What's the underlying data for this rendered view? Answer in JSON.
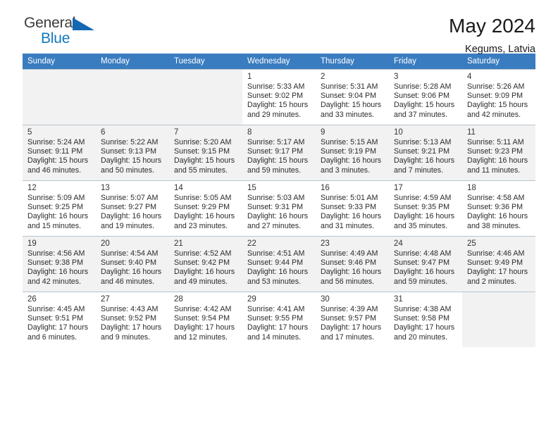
{
  "brand": {
    "name_part1": "General",
    "name_part2": "Blue",
    "triangle_icon": "triangle-icon",
    "accent_color": "#1268b3"
  },
  "header": {
    "title": "May 2024",
    "subtitle": "Kegums, Latvia"
  },
  "calendar": {
    "header_color": "#3a7cc0",
    "weekdays": [
      "Sunday",
      "Monday",
      "Tuesday",
      "Wednesday",
      "Thursday",
      "Friday",
      "Saturday"
    ],
    "labels": {
      "sunrise": "Sunrise:",
      "sunset": "Sunset:",
      "daylight": "Daylight:"
    },
    "weeks": [
      [
        {
          "day": "",
          "sunrise": "",
          "sunset": "",
          "daylight": "",
          "empty": true
        },
        {
          "day": "",
          "sunrise": "",
          "sunset": "",
          "daylight": "",
          "empty": true
        },
        {
          "day": "",
          "sunrise": "",
          "sunset": "",
          "daylight": "",
          "empty": true
        },
        {
          "day": "1",
          "sunrise": "Sunrise: 5:33 AM",
          "sunset": "Sunset: 9:02 PM",
          "daylight": "Daylight: 15 hours and 29 minutes.",
          "empty": false
        },
        {
          "day": "2",
          "sunrise": "Sunrise: 5:31 AM",
          "sunset": "Sunset: 9:04 PM",
          "daylight": "Daylight: 15 hours and 33 minutes.",
          "empty": false
        },
        {
          "day": "3",
          "sunrise": "Sunrise: 5:28 AM",
          "sunset": "Sunset: 9:06 PM",
          "daylight": "Daylight: 15 hours and 37 minutes.",
          "empty": false
        },
        {
          "day": "4",
          "sunrise": "Sunrise: 5:26 AM",
          "sunset": "Sunset: 9:09 PM",
          "daylight": "Daylight: 15 hours and 42 minutes.",
          "empty": false
        }
      ],
      [
        {
          "day": "5",
          "sunrise": "Sunrise: 5:24 AM",
          "sunset": "Sunset: 9:11 PM",
          "daylight": "Daylight: 15 hours and 46 minutes.",
          "empty": false
        },
        {
          "day": "6",
          "sunrise": "Sunrise: 5:22 AM",
          "sunset": "Sunset: 9:13 PM",
          "daylight": "Daylight: 15 hours and 50 minutes.",
          "empty": false
        },
        {
          "day": "7",
          "sunrise": "Sunrise: 5:20 AM",
          "sunset": "Sunset: 9:15 PM",
          "daylight": "Daylight: 15 hours and 55 minutes.",
          "empty": false
        },
        {
          "day": "8",
          "sunrise": "Sunrise: 5:17 AM",
          "sunset": "Sunset: 9:17 PM",
          "daylight": "Daylight: 15 hours and 59 minutes.",
          "empty": false
        },
        {
          "day": "9",
          "sunrise": "Sunrise: 5:15 AM",
          "sunset": "Sunset: 9:19 PM",
          "daylight": "Daylight: 16 hours and 3 minutes.",
          "empty": false
        },
        {
          "day": "10",
          "sunrise": "Sunrise: 5:13 AM",
          "sunset": "Sunset: 9:21 PM",
          "daylight": "Daylight: 16 hours and 7 minutes.",
          "empty": false
        },
        {
          "day": "11",
          "sunrise": "Sunrise: 5:11 AM",
          "sunset": "Sunset: 9:23 PM",
          "daylight": "Daylight: 16 hours and 11 minutes.",
          "empty": false
        }
      ],
      [
        {
          "day": "12",
          "sunrise": "Sunrise: 5:09 AM",
          "sunset": "Sunset: 9:25 PM",
          "daylight": "Daylight: 16 hours and 15 minutes.",
          "empty": false
        },
        {
          "day": "13",
          "sunrise": "Sunrise: 5:07 AM",
          "sunset": "Sunset: 9:27 PM",
          "daylight": "Daylight: 16 hours and 19 minutes.",
          "empty": false
        },
        {
          "day": "14",
          "sunrise": "Sunrise: 5:05 AM",
          "sunset": "Sunset: 9:29 PM",
          "daylight": "Daylight: 16 hours and 23 minutes.",
          "empty": false
        },
        {
          "day": "15",
          "sunrise": "Sunrise: 5:03 AM",
          "sunset": "Sunset: 9:31 PM",
          "daylight": "Daylight: 16 hours and 27 minutes.",
          "empty": false
        },
        {
          "day": "16",
          "sunrise": "Sunrise: 5:01 AM",
          "sunset": "Sunset: 9:33 PM",
          "daylight": "Daylight: 16 hours and 31 minutes.",
          "empty": false
        },
        {
          "day": "17",
          "sunrise": "Sunrise: 4:59 AM",
          "sunset": "Sunset: 9:35 PM",
          "daylight": "Daylight: 16 hours and 35 minutes.",
          "empty": false
        },
        {
          "day": "18",
          "sunrise": "Sunrise: 4:58 AM",
          "sunset": "Sunset: 9:36 PM",
          "daylight": "Daylight: 16 hours and 38 minutes.",
          "empty": false
        }
      ],
      [
        {
          "day": "19",
          "sunrise": "Sunrise: 4:56 AM",
          "sunset": "Sunset: 9:38 PM",
          "daylight": "Daylight: 16 hours and 42 minutes.",
          "empty": false
        },
        {
          "day": "20",
          "sunrise": "Sunrise: 4:54 AM",
          "sunset": "Sunset: 9:40 PM",
          "daylight": "Daylight: 16 hours and 46 minutes.",
          "empty": false
        },
        {
          "day": "21",
          "sunrise": "Sunrise: 4:52 AM",
          "sunset": "Sunset: 9:42 PM",
          "daylight": "Daylight: 16 hours and 49 minutes.",
          "empty": false
        },
        {
          "day": "22",
          "sunrise": "Sunrise: 4:51 AM",
          "sunset": "Sunset: 9:44 PM",
          "daylight": "Daylight: 16 hours and 53 minutes.",
          "empty": false
        },
        {
          "day": "23",
          "sunrise": "Sunrise: 4:49 AM",
          "sunset": "Sunset: 9:46 PM",
          "daylight": "Daylight: 16 hours and 56 minutes.",
          "empty": false
        },
        {
          "day": "24",
          "sunrise": "Sunrise: 4:48 AM",
          "sunset": "Sunset: 9:47 PM",
          "daylight": "Daylight: 16 hours and 59 minutes.",
          "empty": false
        },
        {
          "day": "25",
          "sunrise": "Sunrise: 4:46 AM",
          "sunset": "Sunset: 9:49 PM",
          "daylight": "Daylight: 17 hours and 2 minutes.",
          "empty": false
        }
      ],
      [
        {
          "day": "26",
          "sunrise": "Sunrise: 4:45 AM",
          "sunset": "Sunset: 9:51 PM",
          "daylight": "Daylight: 17 hours and 6 minutes.",
          "empty": false
        },
        {
          "day": "27",
          "sunrise": "Sunrise: 4:43 AM",
          "sunset": "Sunset: 9:52 PM",
          "daylight": "Daylight: 17 hours and 9 minutes.",
          "empty": false
        },
        {
          "day": "28",
          "sunrise": "Sunrise: 4:42 AM",
          "sunset": "Sunset: 9:54 PM",
          "daylight": "Daylight: 17 hours and 12 minutes.",
          "empty": false
        },
        {
          "day": "29",
          "sunrise": "Sunrise: 4:41 AM",
          "sunset": "Sunset: 9:55 PM",
          "daylight": "Daylight: 17 hours and 14 minutes.",
          "empty": false
        },
        {
          "day": "30",
          "sunrise": "Sunrise: 4:39 AM",
          "sunset": "Sunset: 9:57 PM",
          "daylight": "Daylight: 17 hours and 17 minutes.",
          "empty": false
        },
        {
          "day": "31",
          "sunrise": "Sunrise: 4:38 AM",
          "sunset": "Sunset: 9:58 PM",
          "daylight": "Daylight: 17 hours and 20 minutes.",
          "empty": false
        },
        {
          "day": "",
          "sunrise": "",
          "sunset": "",
          "daylight": "",
          "empty": true
        }
      ]
    ]
  }
}
